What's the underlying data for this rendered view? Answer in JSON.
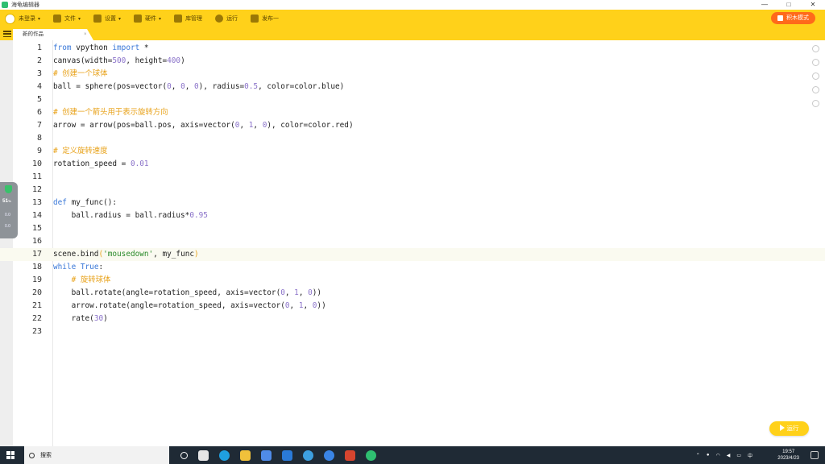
{
  "window": {
    "title": "海龟编辑器",
    "controls": [
      "—",
      "□",
      "✕"
    ]
  },
  "menubar": {
    "items": [
      {
        "label": "未登录",
        "icon": "avatar-icon",
        "caret": true
      },
      {
        "label": "文件",
        "icon": "folder-icon",
        "caret": true
      },
      {
        "label": "设置",
        "icon": "gear-icon",
        "caret": true
      },
      {
        "label": "硬件",
        "icon": "chip-icon",
        "caret": true
      },
      {
        "label": "库管理",
        "icon": "library-icon",
        "caret": false
      },
      {
        "label": "运行",
        "icon": "play-icon",
        "caret": false
      },
      {
        "label": "发布一",
        "icon": "send-icon",
        "caret": false
      }
    ],
    "mode_button": "积木模式"
  },
  "tabs": [
    {
      "label": "新的作品",
      "close": "×"
    }
  ],
  "editor": {
    "lines": [
      {
        "n": "1",
        "html": "<span class=\"kw\">from</span> vpython <span class=\"kw\">import</span> *"
      },
      {
        "n": "2",
        "html": "canvas(width=<span class=\"num\">500</span>, height=<span class=\"num\">400</span>)"
      },
      {
        "n": "3",
        "html": "<span class=\"cm\"># 创建一个球体</span>"
      },
      {
        "n": "4",
        "html": "ball = sphere(pos=vector(<span class=\"num\">0</span>, <span class=\"num\">0</span>, <span class=\"num\">0</span>), radius=<span class=\"num\">0.5</span>, color=color.blue)"
      },
      {
        "n": "5",
        "html": ""
      },
      {
        "n": "6",
        "html": "<span class=\"cm\"># 创建一个箭头用于表示旋转方向</span>"
      },
      {
        "n": "7",
        "html": "arrow = arrow(pos=ball.pos, axis=vector(<span class=\"num\">0</span>, <span class=\"num\">1</span>, <span class=\"num\">0</span>), color=color.red)"
      },
      {
        "n": "8",
        "html": ""
      },
      {
        "n": "9",
        "html": "<span class=\"cm\"># 定义旋转速度</span>"
      },
      {
        "n": "10",
        "html": "rotation_speed = <span class=\"num\">0.01</span>"
      },
      {
        "n": "11",
        "html": ""
      },
      {
        "n": "12",
        "html": ""
      },
      {
        "n": "13",
        "html": "<span class=\"kw\">def</span> my_func():"
      },
      {
        "n": "14",
        "html": "    ball.radius = ball.radius*<span class=\"num\">0.95</span>"
      },
      {
        "n": "15",
        "html": ""
      },
      {
        "n": "16",
        "html": ""
      },
      {
        "n": "17",
        "html": "scene.bind<span class=\"br\">(</span><span class=\"str\">'mousedown'</span>, my_func<span class=\"br\">)</span>",
        "active": true
      },
      {
        "n": "18",
        "html": "<span class=\"kw\">while</span> <span class=\"kw\">True</span>:"
      },
      {
        "n": "19",
        "html": "    <span class=\"cm\"># 旋转球体</span>"
      },
      {
        "n": "20",
        "html": "    ball.rotate(angle=rotation_speed, axis=vector(<span class=\"num\">0</span>, <span class=\"num\">1</span>, <span class=\"num\">0</span>))"
      },
      {
        "n": "21",
        "html": "    arrow.rotate(angle=rotation_speed, axis=vector(<span class=\"num\">0</span>, <span class=\"num\">1</span>, <span class=\"num\">0</span>))"
      },
      {
        "n": "22",
        "html": "    rate(<span class=\"num\">30</span>)"
      },
      {
        "n": "23",
        "html": ""
      }
    ]
  },
  "right_toolbar": [
    "undo-icon",
    "redo-icon",
    "zoom-in-icon",
    "format-icon",
    "zoom-out-icon"
  ],
  "float_widget": {
    "percent": "51",
    "unit": "%",
    "speed_up": "0.0",
    "speed_down": "0.0"
  },
  "run_button": "运行",
  "taskbar": {
    "search_placeholder": "搜索",
    "time": "19:57",
    "date": "2023/4/23",
    "ime": "中",
    "tray_icons": [
      "chevron-up-icon",
      "mic-icon",
      "network-icon",
      "volume-icon",
      "keyboard-icon"
    ]
  },
  "colors": {
    "accent": "#ffd11a",
    "mode_button": "#ff6a1a",
    "keyword": "#3a78d8",
    "number": "#8a72c9",
    "string": "#2a8a2a",
    "comment": "#e8a21a"
  }
}
